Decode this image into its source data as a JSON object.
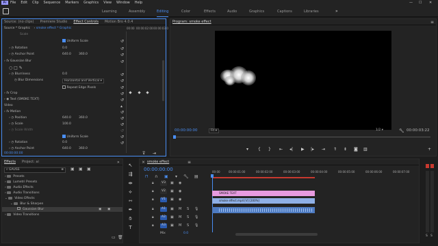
{
  "menu": {
    "logo": "Pr",
    "items": [
      "File",
      "Edit",
      "Clip",
      "Sequence",
      "Markers",
      "Graphics",
      "View",
      "Window",
      "Help"
    ]
  },
  "workspaces": {
    "tabs": [
      "Learning",
      "Assembly",
      "Editing",
      "Color",
      "Effects",
      "Audio",
      "Graphics",
      "Captions",
      "Libraries"
    ],
    "active": "Editing",
    "more": "»"
  },
  "source_panel": {
    "tabs": [
      "Source: (no clips)",
      "Premiere Studio",
      "Effect Controls",
      "Motion Bro 4.0.4"
    ],
    "active_tab": "Effect Controls",
    "master": "Source * Graphic",
    "sequence": "smoke effect * Graphic",
    "ruler_start": "00:00",
    "ruler_mid": "00:00:02:00",
    "ruler_end": "00:00:03:0",
    "rows": {
      "scale_label": "Scale",
      "uniform_scale": "Uniform Scale",
      "rotation1_label": "Rotation",
      "rotation1_value": "0.0",
      "anchor1_label": "Anchor Point",
      "anchor1_x": "640.0",
      "anchor1_y": "360.0",
      "gaussian_label": "Gaussian Blur",
      "blurriness_label": "Blurriness",
      "blurriness_value": "0.0",
      "blur_dim_label": "Blur Dimensions",
      "blur_dim_value": "Horizontal and Vertical",
      "repeat_label": "Repeat Edge Pixels",
      "crop_label": "Crop",
      "text_label": "Text (SMOKE TEXT)",
      "video_label": "Video",
      "motion_label": "Motion",
      "position_label": "Position",
      "position_x": "640.0",
      "position_y": "360.0",
      "scale2_label": "Scale",
      "scale2_value": "100.0",
      "scale_width_label": "Scale Width",
      "uniform_scale2": "Uniform Scale",
      "rotation2_label": "Rotation",
      "rotation2_value": "0.0",
      "anchor2_label": "Anchor Point",
      "anchor2_x": "640.0",
      "anchor2_y": "360.0"
    },
    "timecode": "00:00:00:00"
  },
  "program": {
    "title": "Program: smoke effect",
    "timecode": "00:00:00:00",
    "fit": "Fit",
    "quality": "1/2",
    "duration": "00:00:03:22"
  },
  "effects_panel": {
    "tabs": [
      "Effects",
      "Project: ai"
    ],
    "active_tab": "Effects",
    "search": "GAUSS",
    "items": [
      {
        "label": "Presets",
        "indent": 0
      },
      {
        "label": "Lumetri Presets",
        "indent": 0
      },
      {
        "label": "Audio Effects",
        "indent": 0
      },
      {
        "label": "Audio Transitions",
        "indent": 0
      },
      {
        "label": "Video Effects",
        "indent": 0
      },
      {
        "label": "Blur & Sharpen",
        "indent": 1
      },
      {
        "label": "Gaussian Blur",
        "indent": 2
      },
      {
        "label": "Video Transitions",
        "indent": 0
      }
    ],
    "selected_item": "Gaussian Blur"
  },
  "timeline": {
    "tab": "smoke effect",
    "timecode": "00:00:00:00",
    "ruler": [
      "00:00",
      "00:00:01:00",
      "00:00:02:00",
      "00:00:03:00",
      "00:00:04:00",
      "00:00:05:00",
      "00:00:06:00",
      "00:00:07:00"
    ],
    "video_tracks": [
      "V3",
      "V2",
      "V1"
    ],
    "audio_tracks": [
      "A1",
      "A2",
      "A3"
    ],
    "mix_label": "Mix",
    "mix_value": "0.0",
    "clips": {
      "text_clip": "SMOKE TEXT",
      "video_clip": "smoke effect.mp4 [V] [200%]"
    },
    "colors": {
      "text_clip": "#e79be0",
      "video_clip": "#8fb0e6",
      "audio_clip": "#4e7bc1"
    }
  },
  "colors": {
    "accent": "#4a8ff5",
    "background": "#1d1d1d",
    "panel": "#232323"
  }
}
